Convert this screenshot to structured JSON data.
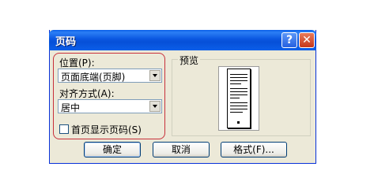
{
  "dialog": {
    "title": "页码"
  },
  "position": {
    "label": "位置(P):",
    "value": "页面底端(页脚)"
  },
  "alignment": {
    "label": "对齐方式(A):",
    "value": "居中"
  },
  "first_page": {
    "label": "首页显示页码(S)",
    "checked": false
  },
  "preview": {
    "label": "预览"
  },
  "buttons": {
    "ok": "确定",
    "cancel": "取消",
    "format": "格式(F)..."
  },
  "colors": {
    "title_bar": "#0a5ee8",
    "dialog_bg": "#ece9d8",
    "highlight_outline": "#c8303a",
    "close_button": "#c6371a"
  },
  "icons": {
    "help": "question-mark",
    "close": "x-mark"
  }
}
